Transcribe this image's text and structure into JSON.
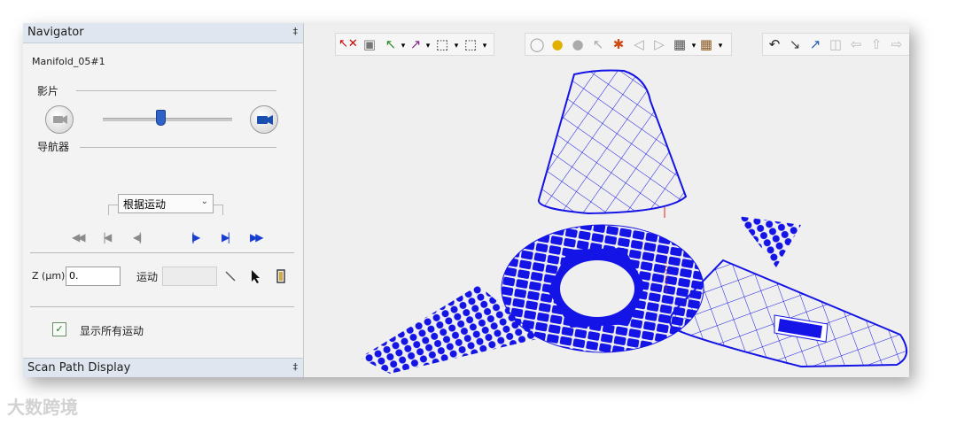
{
  "navigator": {
    "title": "Navigator",
    "pin": "‡",
    "object_name": "Manifold_05#1",
    "film_label": "影片",
    "navigator_label": "导航器",
    "slider_level": 0.44,
    "mode_select": {
      "value": "根据运动"
    },
    "z_label": "Z (μm)",
    "z_value": "0.",
    "motion_label": "运动",
    "motion_value": "",
    "show_all_label": "显示所有运动",
    "show_all_checked": true
  },
  "scan_path": {
    "title": "Scan Path Display",
    "pin": "‡"
  },
  "watermark": {
    "text": "大数跨境"
  },
  "toolbar": {
    "group1": [
      "select-delete-icon",
      "frame-icon",
      "select-arrow-icon",
      "edit-arrow-icon",
      "box-select-icon",
      "region-select-icon"
    ],
    "group2": [
      "bulb-off-icon",
      "bulb-on-icon",
      "bulb-group-icon",
      "pointer-disabled-icon",
      "color-pick-icon",
      "left-arrow-icon",
      "right-arrow-icon",
      "cube-view-icon",
      "cube-pick-icon"
    ],
    "group3": [
      "undo-icon",
      "pointer-arrow-icon",
      "path-edit-icon",
      "copy-disabled-icon",
      "move-left-disabled-icon",
      "move-up-disabled-icon",
      "move-right-disabled-icon"
    ]
  },
  "colors": {
    "accent": "#1414e6",
    "panel_header": "#dfe6ef",
    "panel_bg": "#f3f3f3"
  }
}
